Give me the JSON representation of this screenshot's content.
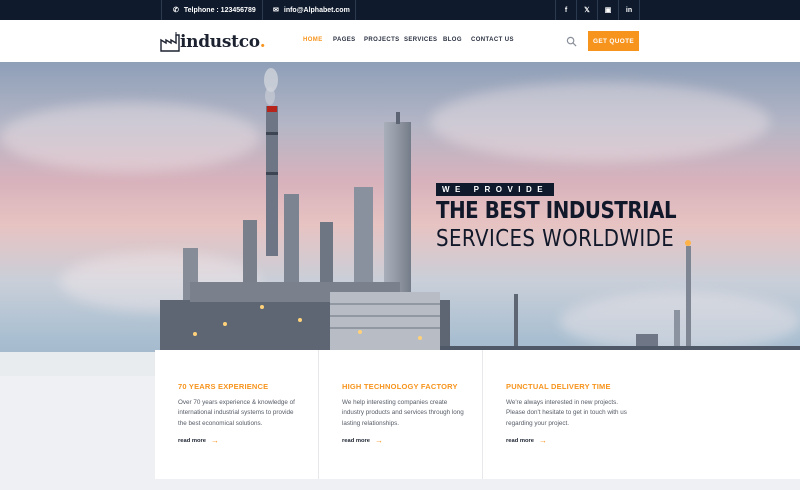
{
  "topbar": {
    "phone_label": "Telphone : 123456789",
    "email_label": "info@Alphabet.com",
    "social": [
      {
        "label": "f",
        "icon": "facebook-icon"
      },
      {
        "label": "𝕏",
        "icon": "x-icon"
      },
      {
        "label": "▣",
        "icon": "discord-icon"
      },
      {
        "label": "in",
        "icon": "linkedin-icon"
      }
    ]
  },
  "header": {
    "logo_text": "industco",
    "logo_dot": ".",
    "nav": [
      "HOME",
      "PAGES",
      "PROJECTS",
      "SERVICES",
      "BLOG",
      "CONTACT US"
    ],
    "active_nav": "HOME",
    "quote_button": "GET QUOTE"
  },
  "hero": {
    "tag": "WE PROVIDE",
    "title_line1": "THE BEST INDUSTRIAL",
    "title_line2": "SERVICES WORLDWIDE"
  },
  "features": [
    {
      "title": "70 YEARS EXPERIENCE",
      "text": "Over 70 years experience & knowledge of international industrial systems to provide the best economical solutions.",
      "link": "read more"
    },
    {
      "title": "HIGH TECHNOLOGY FACTORY",
      "text": "We help interesting companies create industry products and services through long lasting relationships.",
      "link": "read more"
    },
    {
      "title": "PUNCTUAL DELIVERY TIME",
      "text": "We're always interested in new projects. Please don't hesitate to get in touch with us regarding your project.",
      "link": "read more"
    }
  ],
  "colors": {
    "accent": "#f7941d",
    "dark": "#0f1b2d"
  }
}
